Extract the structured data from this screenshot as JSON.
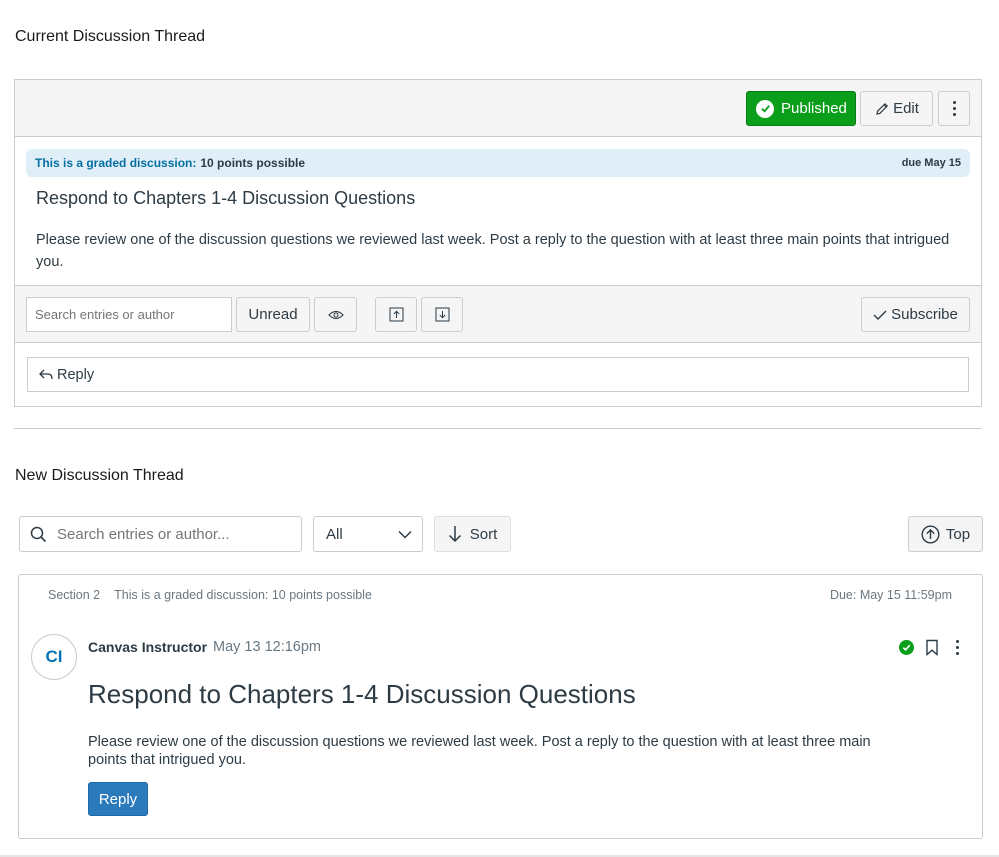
{
  "current": {
    "heading": "Current Discussion Thread",
    "published_label": "Published",
    "edit_label": "Edit",
    "graded_label": "This is a graded discussion:",
    "graded_points": "10 points possible",
    "due": "due May 15",
    "title": "Respond to Chapters 1-4 Discussion Questions",
    "body": "Please review one of the discussion questions we reviewed last week. Post a reply to the question with at least three main points that intrigued you.",
    "search_placeholder": "Search entries or author",
    "unread_label": "Unread",
    "subscribe_label": "Subscribe",
    "reply_label": "Reply"
  },
  "new": {
    "heading": "New Discussion Thread",
    "search_placeholder": "Search entries or author...",
    "filter_value": "All",
    "sort_label": "Sort",
    "top_label": "Top",
    "section": "Section 2",
    "graded_text": "This is a graded discussion: 10 points possible",
    "due": "Due: May 15 11:59pm",
    "avatar_initials": "CI",
    "author": "Canvas Instructor",
    "posted": "May 13 12:16pm",
    "title": "Respond to Chapters 1-4 Discussion Questions",
    "body": "Please review one of the discussion questions we reviewed last week. Post a reply to the question with at least three main points that intrigued you.",
    "reply_label": "Reply"
  },
  "icons": [
    "check-circle-icon",
    "pencil-icon",
    "kebab-menu-icon",
    "eye-icon",
    "collapse-up-icon",
    "expand-down-icon",
    "checkmark-icon",
    "reply-arrow-icon",
    "search-icon",
    "chevron-down-icon",
    "arrow-down-icon",
    "arrow-up-circle-icon",
    "published-check-icon",
    "bookmark-icon"
  ],
  "colors": {
    "published_green": "#0b9e1a",
    "link_blue": "#0770a3",
    "reply_button_blue": "#2b7abc",
    "graded_bar_bg": "#e0eef8",
    "text": "#2d3b45"
  }
}
